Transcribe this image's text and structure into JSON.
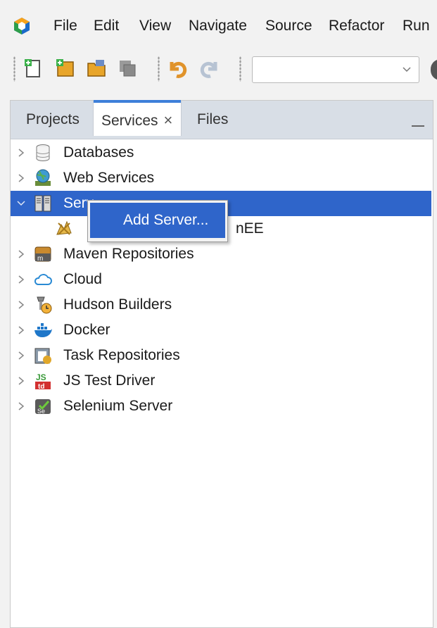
{
  "menubar": {
    "items": [
      {
        "label": "File"
      },
      {
        "label": "Edit"
      },
      {
        "label": "View"
      },
      {
        "label": "Navigate"
      },
      {
        "label": "Source"
      },
      {
        "label": "Refactor"
      },
      {
        "label": "Run"
      }
    ]
  },
  "toolbar": {
    "icons": [
      "new-file-icon",
      "new-project-icon",
      "open-project-icon",
      "save-all-icon",
      "undo-icon",
      "redo-icon"
    ],
    "configuration_select": {
      "value": ""
    }
  },
  "tabs": [
    {
      "label": "Projects",
      "active": false
    },
    {
      "label": "Services",
      "active": true,
      "close": "×"
    },
    {
      "label": "Files",
      "active": false
    }
  ],
  "tree": {
    "nodes": [
      {
        "label": "Databases",
        "icon": "database-icon",
        "expanded": false
      },
      {
        "label": "Web Services",
        "icon": "web-services-icon",
        "expanded": false
      },
      {
        "label": "Servers",
        "display": "Serv",
        "icon": "servers-icon",
        "expanded": true,
        "selected": true
      },
      {
        "label": "Apache ... TomEE",
        "display": "nEE",
        "icon": "tomee-server-icon",
        "child": true
      },
      {
        "label": "Maven Repositories",
        "icon": "maven-icon",
        "expanded": false
      },
      {
        "label": "Cloud",
        "icon": "cloud-icon",
        "expanded": false
      },
      {
        "label": "Hudson Builders",
        "icon": "hudson-icon",
        "expanded": false
      },
      {
        "label": "Docker",
        "icon": "docker-icon",
        "expanded": false
      },
      {
        "label": "Task Repositories",
        "icon": "task-repo-icon",
        "expanded": false
      },
      {
        "label": "JS Test Driver",
        "icon": "js-test-driver-icon",
        "expanded": false
      },
      {
        "label": "Selenium Server",
        "icon": "selenium-icon",
        "expanded": false
      }
    ]
  },
  "context_menu": {
    "items": [
      {
        "label": "Add Server..."
      }
    ]
  },
  "colors": {
    "selection": "#2f65ca",
    "tab_accent": "#3d7fd9",
    "tabbar": "#d8dee6"
  }
}
